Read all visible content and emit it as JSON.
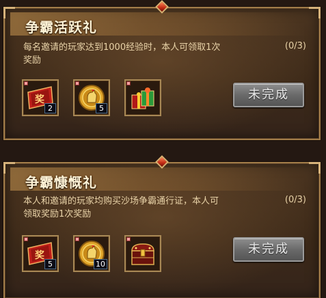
{
  "cards": [
    {
      "title": "争霸活跃礼",
      "desc_line1": "每名邀请的玩家达到1000经验时，本人可领取1次",
      "desc_line2": "奖励",
      "progress": "(0/3)",
      "rewards": [
        {
          "icon": "reward-ticket-icon",
          "qty": "2"
        },
        {
          "icon": "golden-rooster-coin-icon",
          "qty": "5"
        },
        {
          "icon": "gift-box-icon",
          "qty": ""
        }
      ],
      "button": "未完成"
    },
    {
      "title": "争霸慷慨礼",
      "desc_line1": "本人和邀请的玩家均购买沙场争霸通行证，本人可",
      "desc_line2": "领取奖励1次奖励",
      "progress": "(0/3)",
      "rewards": [
        {
          "icon": "reward-ticket-icon",
          "qty": "5"
        },
        {
          "icon": "golden-rooster-coin-icon",
          "qty": "10"
        },
        {
          "icon": "treasure-chest-icon",
          "qty": ""
        }
      ],
      "button": "未完成"
    }
  ],
  "colors": {
    "accent_gold": "#a27d49",
    "text_light": "#e9d3a8",
    "title_text": "#fff3d6",
    "button_gray": "#6a6a6a"
  }
}
